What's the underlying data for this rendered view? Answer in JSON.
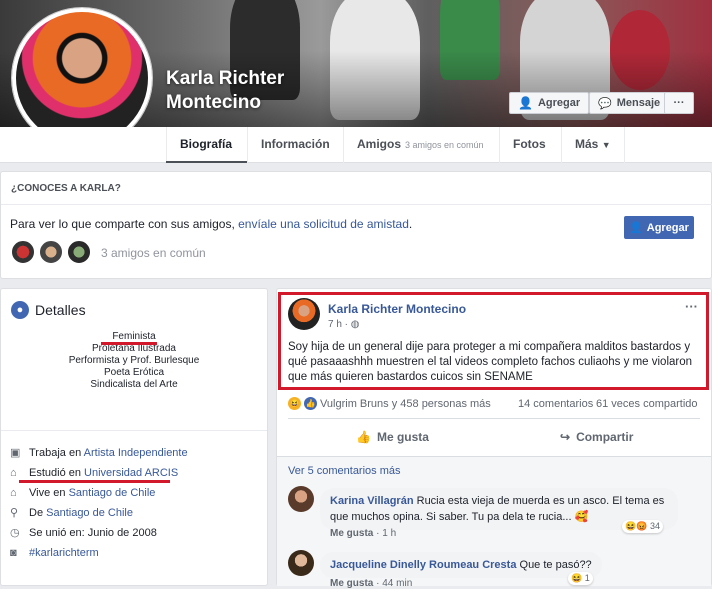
{
  "profile": {
    "name_line1": "Karla Richter",
    "name_line2": "Montecino",
    "add_label": "Agregar",
    "message_label": "Mensaje",
    "more_label": "···"
  },
  "tabs": [
    {
      "label": "Biografía"
    },
    {
      "label": "Información"
    },
    {
      "label": "Amigos",
      "extra": "3 amigos en común"
    },
    {
      "label": "Fotos"
    },
    {
      "label": "Más"
    }
  ],
  "know": {
    "title": "¿CONOCES A KARLA?",
    "text_before": "Para ver lo que comparte con sus amigos, ",
    "link": "envíale una solicitud de amistad",
    "text_after": ".",
    "mutual": "3 amigos en común",
    "add_label": "Agregar"
  },
  "details": {
    "title": "Detalles",
    "bio": [
      "Feminista",
      "Proletana Ilustrada",
      "Performista y Prof. Burlesque",
      "Poeta Erótica",
      "Sindicalista del Arte"
    ],
    "items": [
      {
        "icon": "briefcase-icon",
        "prefix": "Trabaja en ",
        "link": "Artista Independiente"
      },
      {
        "icon": "graduation-cap-icon",
        "prefix": "Estudió en ",
        "link": "Universidad ARCIS"
      },
      {
        "icon": "home-icon",
        "prefix": "Vive en ",
        "link": "Santiago de Chile"
      },
      {
        "icon": "location-pin-icon",
        "prefix": "De ",
        "link": "Santiago de Chile"
      },
      {
        "icon": "clock-icon",
        "prefix": "Se unió en: Junio de 2008",
        "link": ""
      },
      {
        "icon": "instagram-icon",
        "prefix": "",
        "link": "#karlarichterm"
      }
    ]
  },
  "post": {
    "author": "Karla Richter Montecino",
    "time": "7 h ·",
    "text": "Soy hija de un general dije para proteger a mi compañera malditos bastardos y qué pasaaashhh muestren el tal videos completo fachos culiaohs y me violaron que más quieren bastardos cuicos sin SENAME",
    "more": "···",
    "reactions": "Vulgrim Bruns y 458 personas más",
    "comments": "14 comentarios",
    "shares": "61 veces compartido",
    "like_label": "Me gusta",
    "share_label": "Compartir",
    "more_comments": "Ver 5 comentarios más"
  },
  "comments": [
    {
      "name": "Karina Villagrán",
      "text": " Rucia esta vieja de muerda es un asco. El tema es que muchos opina. Si saber. Tu pa dela te rucia...",
      "like": "Me gusta",
      "time": "1 h",
      "count": "34"
    },
    {
      "name": "Jacqueline Dinelly Roumeau Cresta",
      "text": " Que te pasó??",
      "like": "Me gusta",
      "time": "44 min",
      "count": "1"
    }
  ],
  "colors": {
    "facebook_blue": "#4267b2",
    "link": "#385898",
    "highlight_red": "#d2192b"
  }
}
